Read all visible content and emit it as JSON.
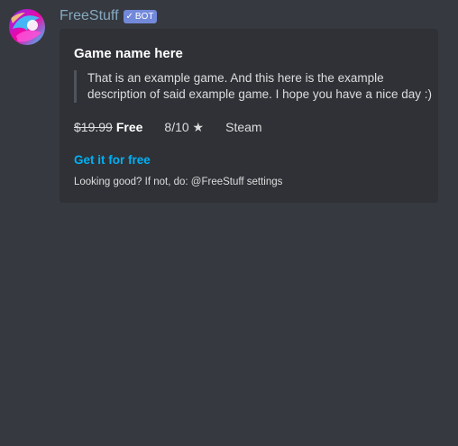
{
  "message": {
    "author": {
      "name": "FreeStuff",
      "bot_tag": "BOT",
      "bot_check": "✓",
      "avatar_icon": "freestuff-avatar-icon"
    },
    "embed": {
      "title": "Game name here",
      "description_lines": [
        "That is an example game. And this here is the example",
        "description of said example game. I hope you have a nice day :)"
      ],
      "old_price": "$19.99",
      "new_price": "Free",
      "rating": "8/10 ★",
      "store": "Steam",
      "link_label": "Get it for free",
      "footer": "Looking good? If not, do: @FreeStuff settings"
    }
  },
  "colors": {
    "background": "#36393f",
    "embed_background": "#2f3136",
    "username": "#86a9c1",
    "bot_tag": "#7289da",
    "link": "#00b0f4"
  }
}
